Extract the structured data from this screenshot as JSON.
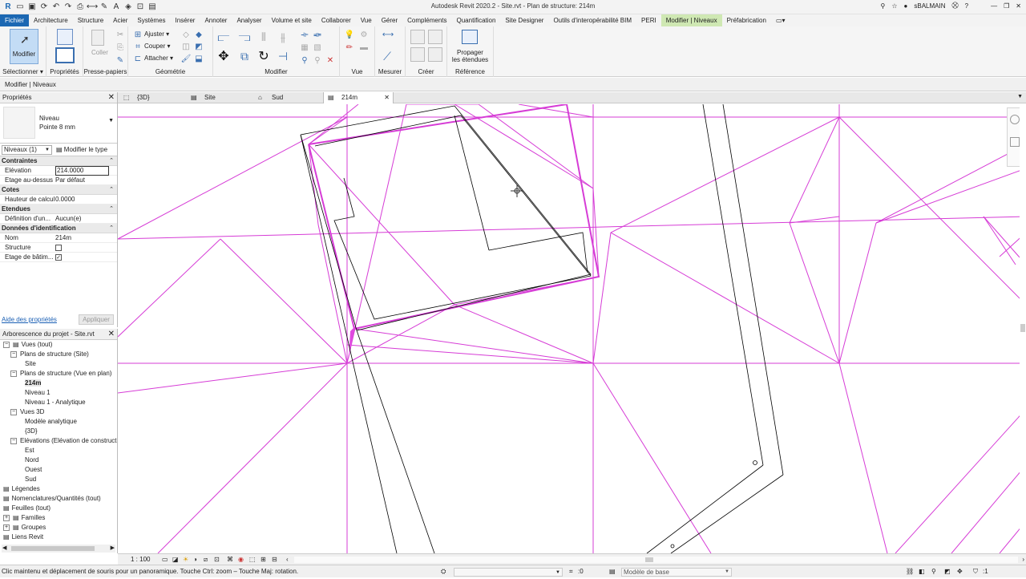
{
  "titlebar": {
    "title": "Autodesk Revit 2020.2 - Site.rvt - Plan de structure: 214m",
    "user": "sBALMAIN",
    "qat_icons": [
      "open-icon",
      "save-icon",
      "sync-icon",
      "undo-icon",
      "redo-icon",
      "print-icon",
      "measure-icon",
      "text-icon",
      "3d-icon",
      "close-views-icon",
      "switch-windows-icon"
    ]
  },
  "menu": {
    "tabs": [
      "Fichier",
      "Architecture",
      "Structure",
      "Acier",
      "Systèmes",
      "Insérer",
      "Annoter",
      "Analyser",
      "Volume et site",
      "Collaborer",
      "Vue",
      "Gérer",
      "Compléments",
      "Quantification",
      "Site Designer",
      "Outils d'interopérabilité BIM",
      "PERI",
      "Modifier | Niveaux",
      "Préfabrication"
    ],
    "active": "Modifier | Niveaux"
  },
  "ribbon": {
    "modify_label": "Modifier",
    "select_label": "Sélectionner",
    "properties_label": "Propriétés",
    "paste_label": "Coller",
    "clipboard_label": "Presse-papiers",
    "geometry_label": "Géométrie",
    "ajuster": "Ajuster",
    "couper": "Couper",
    "attacher": "Attacher",
    "modifier_group_label": "Modifier",
    "vue_label": "Vue",
    "mesurer_label": "Mesurer",
    "creer_label": "Créer",
    "propager_label_1": "Propager",
    "propager_label_2": "les étendues",
    "reference_label": "Référence"
  },
  "context_line": "Modifier | Niveaux",
  "properties": {
    "title": "Propriétés",
    "type_line1": "Niveau",
    "type_line2": "Pointe 8 mm",
    "selector": "Niveaux (1)",
    "edit_type": "Modifier le type",
    "sections": {
      "constraints": "Contraintes",
      "dims": "Cotes",
      "extents": "Etendues",
      "identity": "Données d'identification"
    },
    "rows": {
      "elevation_k": "Elévation",
      "elevation_v": "214.0000",
      "above_k": "Etage au-dessus",
      "above_v": "Par défaut",
      "calc_k": "Hauteur de calcul",
      "calc_v": "0.0000",
      "def_k": "Définition d'un...",
      "def_v": "Aucun(e)",
      "name_k": "Nom",
      "name_v": "214m",
      "struct_k": "Structure",
      "struct_checked": false,
      "bldg_k": "Etage de bâtim...",
      "bldg_checked": true
    },
    "help_link": "Aide des propriétés",
    "apply": "Appliquer"
  },
  "browser": {
    "title": "Arborescence du projet - Site.rvt",
    "items": [
      {
        "label": "Vues (tout)",
        "indent": 0,
        "tog": "−",
        "icon": true
      },
      {
        "label": "Plans de structure (Site)",
        "indent": 1,
        "tog": "−"
      },
      {
        "label": "Site",
        "indent": 3
      },
      {
        "label": "Plans de structure (Vue en plan)",
        "indent": 1,
        "tog": "−"
      },
      {
        "label": "214m",
        "indent": 3,
        "bold": true
      },
      {
        "label": "Niveau 1",
        "indent": 3
      },
      {
        "label": "Niveau 1 - Analytique",
        "indent": 3
      },
      {
        "label": "Vues 3D",
        "indent": 1,
        "tog": "−"
      },
      {
        "label": "Modèle analytique",
        "indent": 3
      },
      {
        "label": "{3D}",
        "indent": 3
      },
      {
        "label": "Elévations (Elévation de construction)",
        "indent": 1,
        "tog": "−"
      },
      {
        "label": "Est",
        "indent": 3
      },
      {
        "label": "Nord",
        "indent": 3
      },
      {
        "label": "Ouest",
        "indent": 3
      },
      {
        "label": "Sud",
        "indent": 3
      },
      {
        "label": "Légendes",
        "indent": 0,
        "icon": true
      },
      {
        "label": "Nomenclatures/Quantités (tout)",
        "indent": 0,
        "icon": true
      },
      {
        "label": "Feuilles (tout)",
        "indent": 0,
        "icon": true
      },
      {
        "label": "Familles",
        "indent": 0,
        "tog": "+",
        "icon": true
      },
      {
        "label": "Groupes",
        "indent": 0,
        "tog": "+",
        "icon": true
      },
      {
        "label": "Liens Revit",
        "indent": 0,
        "icon": true
      }
    ]
  },
  "view_tabs": [
    "{3D}",
    "Site",
    "Sud",
    "214m"
  ],
  "active_view_tab": "214m",
  "viewbar": {
    "scale": "1 : 100"
  },
  "status": {
    "message": "Clic maintenu et déplacement de souris pour un panoramique. Touche Ctrl: zoom – Touche Maj: rotation.",
    "count": ":0",
    "model": "Modèle de base"
  },
  "colors": {
    "file_tab": "#1c68b3",
    "context_tab": "#cfe8b3",
    "topo_lines": "#d63cd6",
    "model_lines": "#000000"
  }
}
